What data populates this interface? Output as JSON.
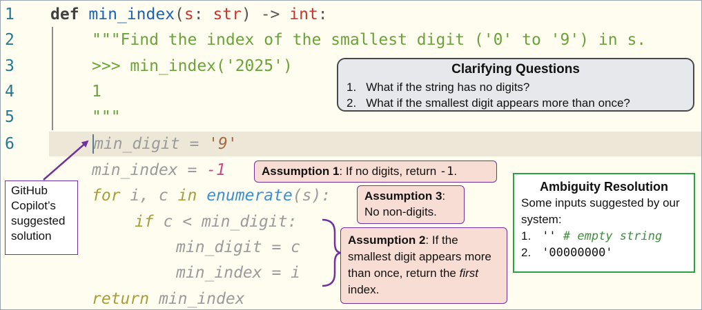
{
  "code": {
    "line_numbers": [
      "1",
      "2",
      "3",
      "4",
      "5",
      "6"
    ],
    "line1": {
      "def": "def",
      "name": "min_index",
      "open": "(",
      "param": "s",
      "colon": ": ",
      "ptype": "str",
      "close": ")",
      "arrow": " -> ",
      "ret": "int",
      "end": ":"
    },
    "line2": "\"\"\"Find the index of the smallest digit ('0' to '9') in s.",
    "line3": ">>> min_index('2025')",
    "line4": "1",
    "line5": "\"\"\"",
    "suggestion": {
      "l6": {
        "a": "min_digit = ",
        "b": "'9'"
      },
      "l7": {
        "a": "min_index = ",
        "b": "-1"
      },
      "l8": {
        "for": "for",
        "a": " i, c ",
        "in": "in",
        "sp": " ",
        "fn": "enumerate",
        "b": "(s):"
      },
      "l9": {
        "if": "if",
        "a": " c < min_digit:"
      },
      "l10": "min_digit = c",
      "l11": "min_index = i",
      "l12": {
        "ret": "return",
        "a": " min_index"
      }
    }
  },
  "clarifying": {
    "title": "Clarifying Questions",
    "q1_num": "1.",
    "q1": "What if the string has no digits?",
    "q2_num": "2.",
    "q2": "What if the smallest digit appears more than once?"
  },
  "assumption1": {
    "title": "Assumption 1",
    "text": ": If no digits, return ",
    "code": "-1",
    "end": "."
  },
  "assumption3": {
    "title": "Assumption 3",
    "colon": ":",
    "text": "No non-digits."
  },
  "assumption2": {
    "title": "Assumption 2",
    "text1": ": If the smallest digit appears more than once, return the ",
    "first": "first",
    "text2": " index."
  },
  "ambiguity": {
    "title": "Ambiguity Resolution",
    "text": "Some inputs suggested by our system:",
    "i1_num": "1.",
    "i1_code": "''",
    "i1_comment": " # empty string",
    "i2_num": "2.",
    "i2_code": "'00000000'"
  },
  "copilot_label": "GitHub Copilot’s suggested solution",
  "colors": {
    "background": "#fffdf0",
    "highlight": "#ece7d6",
    "assumption_fill": "#f7ddd3",
    "accent_purple": "#7030a0",
    "ambiguity_border": "#2aa241",
    "clarifying_fill": "#e7e8eb"
  }
}
